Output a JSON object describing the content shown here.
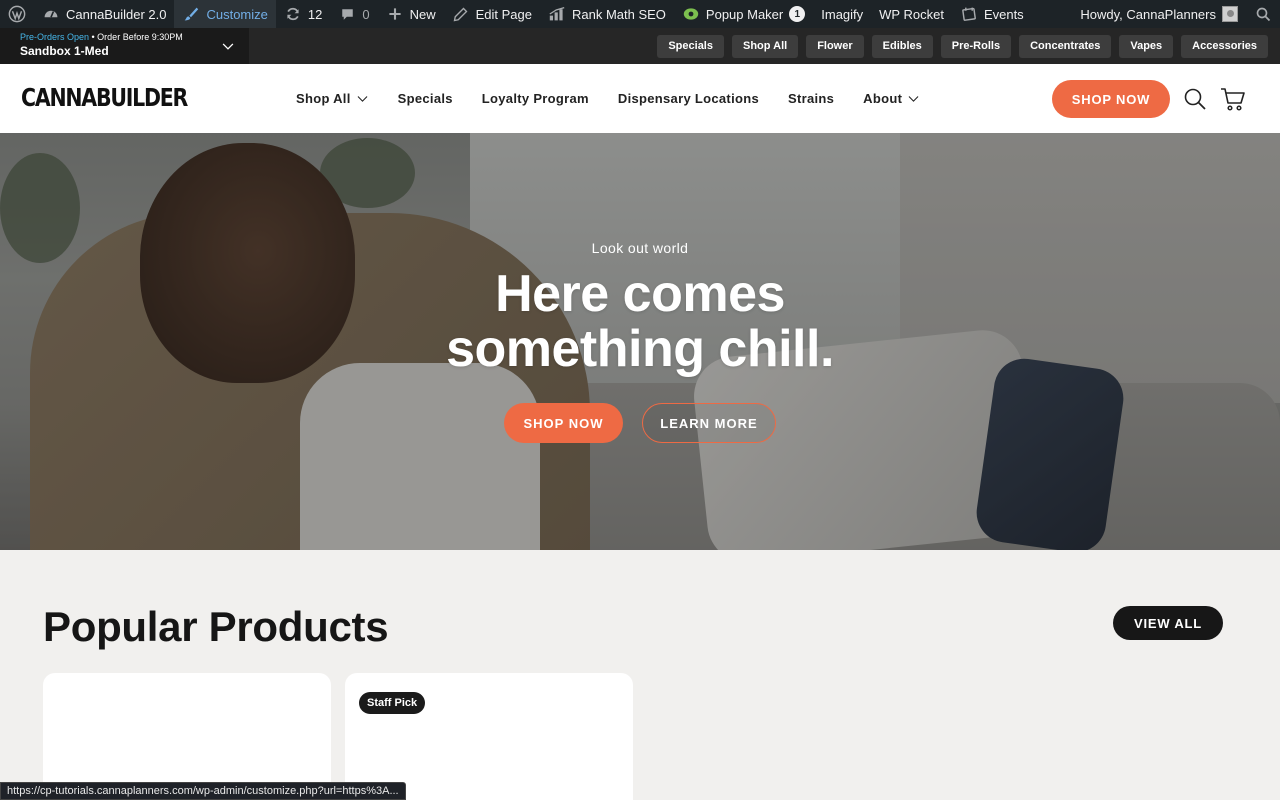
{
  "adminbar": {
    "site_name": "CannaBuilder 2.0",
    "customize": "Customize",
    "updates_count": "12",
    "comments_count": "0",
    "new": "New",
    "edit_page": "Edit Page",
    "rank_math": "Rank Math SEO",
    "popup_maker": "Popup Maker",
    "popup_badge": "1",
    "imagify": "Imagify",
    "wp_rocket": "WP Rocket",
    "events": "Events",
    "howdy": "Howdy, CannaPlanners"
  },
  "store": {
    "status_open": "Pre-Orders Open",
    "status_rest": " • Order Before 9:30PM",
    "name": "Sandbox 1-Med"
  },
  "category_pills": [
    "Specials",
    "Shop All",
    "Flower",
    "Edibles",
    "Pre-Rolls",
    "Concentrates",
    "Vapes",
    "Accessories"
  ],
  "header": {
    "logo": "CANNABUILDER",
    "nav": [
      {
        "label": "Shop All",
        "dropdown": true
      },
      {
        "label": "Specials",
        "dropdown": false
      },
      {
        "label": "Loyalty Program",
        "dropdown": false
      },
      {
        "label": "Dispensary Locations",
        "dropdown": false
      },
      {
        "label": "Strains",
        "dropdown": false
      },
      {
        "label": "About",
        "dropdown": true
      }
    ],
    "shop_now": "SHOP NOW"
  },
  "hero": {
    "eyebrow": "Look out world",
    "headline_line1": "Here comes",
    "headline_line2": "something chill.",
    "shop_now": "SHOP NOW",
    "learn_more": "LEARN MORE"
  },
  "popular": {
    "title": "Popular Products",
    "view_all": "VIEW ALL",
    "card2_badge": "Staff Pick"
  },
  "status_url": "https://cp-tutorials.cannaplanners.com/wp-admin/customize.php?url=https%3A...",
  "colors": {
    "accent": "#ee6a44",
    "admin_bar": "#1d2327",
    "admin_active": "#72aee6",
    "subbar": "#262626",
    "section_bg": "#f1f0ee"
  }
}
